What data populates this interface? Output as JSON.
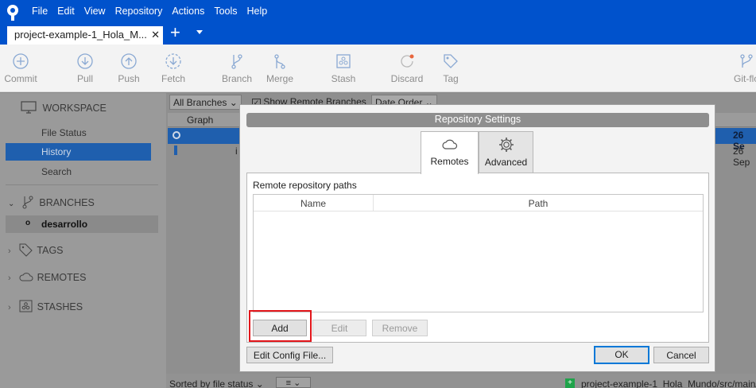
{
  "menu": [
    "File",
    "Edit",
    "View",
    "Repository",
    "Actions",
    "Tools",
    "Help"
  ],
  "tab": {
    "title": "project-example-1_Hola_M...",
    "close": "✕",
    "add": "+"
  },
  "toolbar": [
    {
      "label": "Commit",
      "icon": "plus-circle-icon"
    },
    {
      "label": "Pull",
      "icon": "arrow-down-circle-icon"
    },
    {
      "label": "Push",
      "icon": "arrow-up-circle-icon"
    },
    {
      "label": "Fetch",
      "icon": "fetch-icon"
    },
    {
      "label": "Branch",
      "icon": "branch-icon"
    },
    {
      "label": "Merge",
      "icon": "merge-icon"
    },
    {
      "label": "Stash",
      "icon": "stash-icon"
    },
    {
      "label": "Discard",
      "icon": "discard-icon"
    },
    {
      "label": "Tag",
      "icon": "tag-icon"
    },
    {
      "label": "Git-flo",
      "icon": "gitflow-icon"
    }
  ],
  "sidebar": {
    "workspace": "WORKSPACE",
    "file_status": "File Status",
    "history": "History",
    "search": "Search",
    "branches": "BRANCHES",
    "current_branch": "desarrollo",
    "tags": "TAGS",
    "remotes": "REMOTES",
    "stashes": "STASHES"
  },
  "main": {
    "all_branches": "All Branches",
    "show_remote": "Show Remote Branches",
    "date_order": "Date Order",
    "graph_col": "Graph",
    "date1": "26 Se",
    "date2": "26 Sep",
    "row_initial": "i",
    "sorted": "Sorted by file status",
    "file_path": "project-example-1_Hola_Mundo/src/main/"
  },
  "dialog": {
    "title": "Repository Settings",
    "tab_remotes": "Remotes",
    "tab_advanced": "Advanced",
    "panel_label": "Remote repository paths",
    "col_name": "Name",
    "col_path": "Path",
    "btn_add": "Add",
    "btn_edit": "Edit",
    "btn_remove": "Remove",
    "btn_edit_config": "Edit Config File...",
    "btn_ok": "OK",
    "btn_cancel": "Cancel"
  },
  "colors": {
    "brand": "#0052cc",
    "selection": "#1f5fae",
    "highlight": "#e2161b",
    "ok_border": "#0078d7"
  }
}
